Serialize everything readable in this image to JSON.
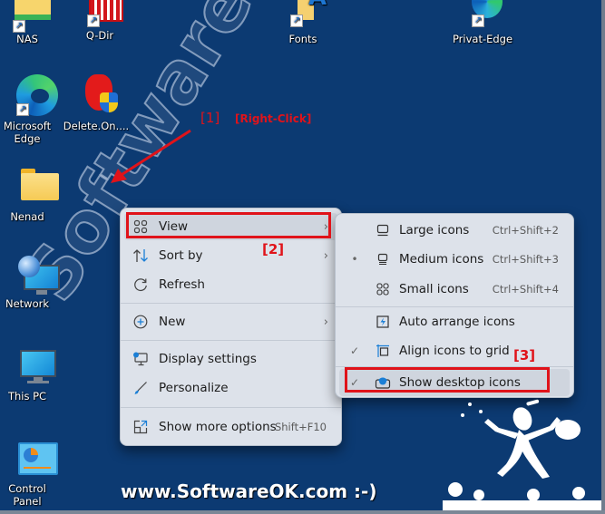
{
  "desktop": {
    "background_color": "#0c3a72",
    "icons": [
      {
        "label": "NAS",
        "icon": "folder-drive-icon",
        "shortcut": true
      },
      {
        "label": "Q-Dir",
        "icon": "q-dir-grid-icon",
        "shortcut": true
      },
      {
        "label": "Fonts",
        "icon": "fonts-folder-icon",
        "shortcut": true
      },
      {
        "label": "Privat-Edge",
        "icon": "edge-icon",
        "shortcut": true
      },
      {
        "label": "Microsoft Edge",
        "icon": "edge-icon",
        "shortcut": true
      },
      {
        "label": "Delete.On....",
        "icon": "red-hand-shield-icon",
        "shortcut": false
      },
      {
        "label": "Nenad",
        "icon": "folder-icon",
        "shortcut": false
      },
      {
        "label": "Network",
        "icon": "network-icon",
        "shortcut": false
      },
      {
        "label": "This PC",
        "icon": "monitor-icon",
        "shortcut": false
      },
      {
        "label": "Control Panel",
        "icon": "control-panel-icon",
        "shortcut": false
      }
    ]
  },
  "annotations": {
    "step1": "[1]",
    "step1_action": "[Right-Click]",
    "step2": "[2]",
    "step3": "[3]",
    "color": "#e0131a"
  },
  "context_menu": {
    "items": [
      {
        "label": "View",
        "icon": "grid-icon",
        "has_submenu": true,
        "highlighted": true
      },
      {
        "label": "Sort by",
        "icon": "sort-icon",
        "has_submenu": true
      },
      {
        "label": "Refresh",
        "icon": "refresh-icon"
      },
      {
        "label": "New",
        "icon": "plus-circle-icon",
        "has_submenu": true
      },
      {
        "label": "Display settings",
        "icon": "display-settings-icon"
      },
      {
        "label": "Personalize",
        "icon": "brush-icon"
      },
      {
        "label": "Show more options",
        "icon": "expand-icon",
        "shortcut": "Shift+F10"
      }
    ]
  },
  "view_submenu": {
    "items": [
      {
        "label": "Large icons",
        "icon": "large-icons-icon",
        "shortcut": "Ctrl+Shift+2",
        "mark": ""
      },
      {
        "label": "Medium icons",
        "icon": "medium-icons-icon",
        "shortcut": "Ctrl+Shift+3",
        "mark": "•"
      },
      {
        "label": "Small icons",
        "icon": "small-icons-icon",
        "shortcut": "Ctrl+Shift+4",
        "mark": ""
      },
      {
        "label": "Auto arrange icons",
        "icon": "auto-arrange-icon",
        "mark": ""
      },
      {
        "label": "Align icons to grid",
        "icon": "align-grid-icon",
        "mark": "✓"
      },
      {
        "label": "Show desktop icons",
        "icon": "show-desktop-icon",
        "mark": "✓",
        "highlighted": true
      }
    ]
  },
  "branding": {
    "watermark": "SoftwareOK.com",
    "footer": "www.SoftwareOK.com :-)"
  }
}
